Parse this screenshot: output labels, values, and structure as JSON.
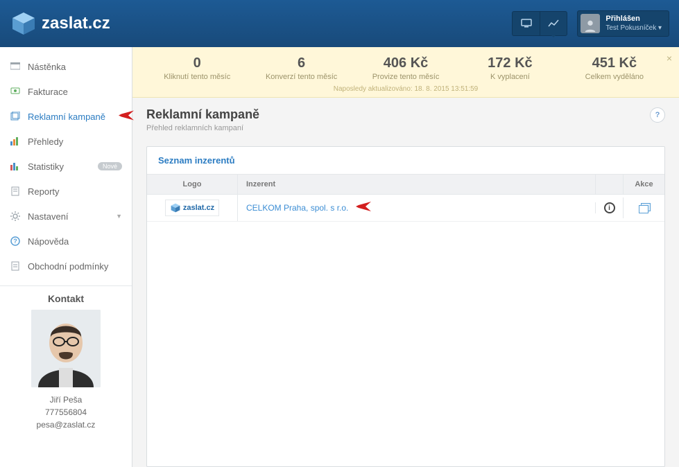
{
  "brand": {
    "name": "zaslat.cz"
  },
  "user": {
    "status": "Přihlášen",
    "name": "Test Pokusníček"
  },
  "sidebar": {
    "items": [
      {
        "label": "Nástěnka",
        "icon": "dashboard"
      },
      {
        "label": "Fakturace",
        "icon": "invoice"
      },
      {
        "label": "Reklamní kampaně",
        "icon": "campaign",
        "active": true
      },
      {
        "label": "Přehledy",
        "icon": "overview"
      },
      {
        "label": "Statistiky",
        "icon": "stats",
        "badge": "Nové"
      },
      {
        "label": "Reporty",
        "icon": "report"
      },
      {
        "label": "Nastavení",
        "icon": "gear",
        "expandable": true
      },
      {
        "label": "Nápověda",
        "icon": "help"
      },
      {
        "label": "Obchodní podmínky",
        "icon": "terms"
      }
    ]
  },
  "contact": {
    "title": "Kontakt",
    "name": "Jiří Peša",
    "phone": "777556804",
    "email": "pesa@zaslat.cz"
  },
  "stats": {
    "items": [
      {
        "value": "0",
        "label": "Kliknutí tento měsíc"
      },
      {
        "value": "6",
        "label": "Konverzí tento měsíc"
      },
      {
        "value": "406 Kč",
        "label": "Provize tento měsíc"
      },
      {
        "value": "172 Kč",
        "label": "K vyplacení"
      },
      {
        "value": "451 Kč",
        "label": "Celkem vyděláno"
      }
    ],
    "updated": "Naposledy aktualizováno: 18. 8. 2015 13:51:59"
  },
  "page": {
    "title": "Reklamní kampaně",
    "subtitle": "Přehled reklamních kampaní",
    "help": "?"
  },
  "panel": {
    "title": "Seznam inzerentů",
    "columns": {
      "logo": "Logo",
      "advertiser": "Inzerent",
      "action": "Akce"
    },
    "rows": [
      {
        "logo_text": "zaslat.cz",
        "advertiser": "CELKOM Praha, spol. s r.o."
      }
    ]
  }
}
